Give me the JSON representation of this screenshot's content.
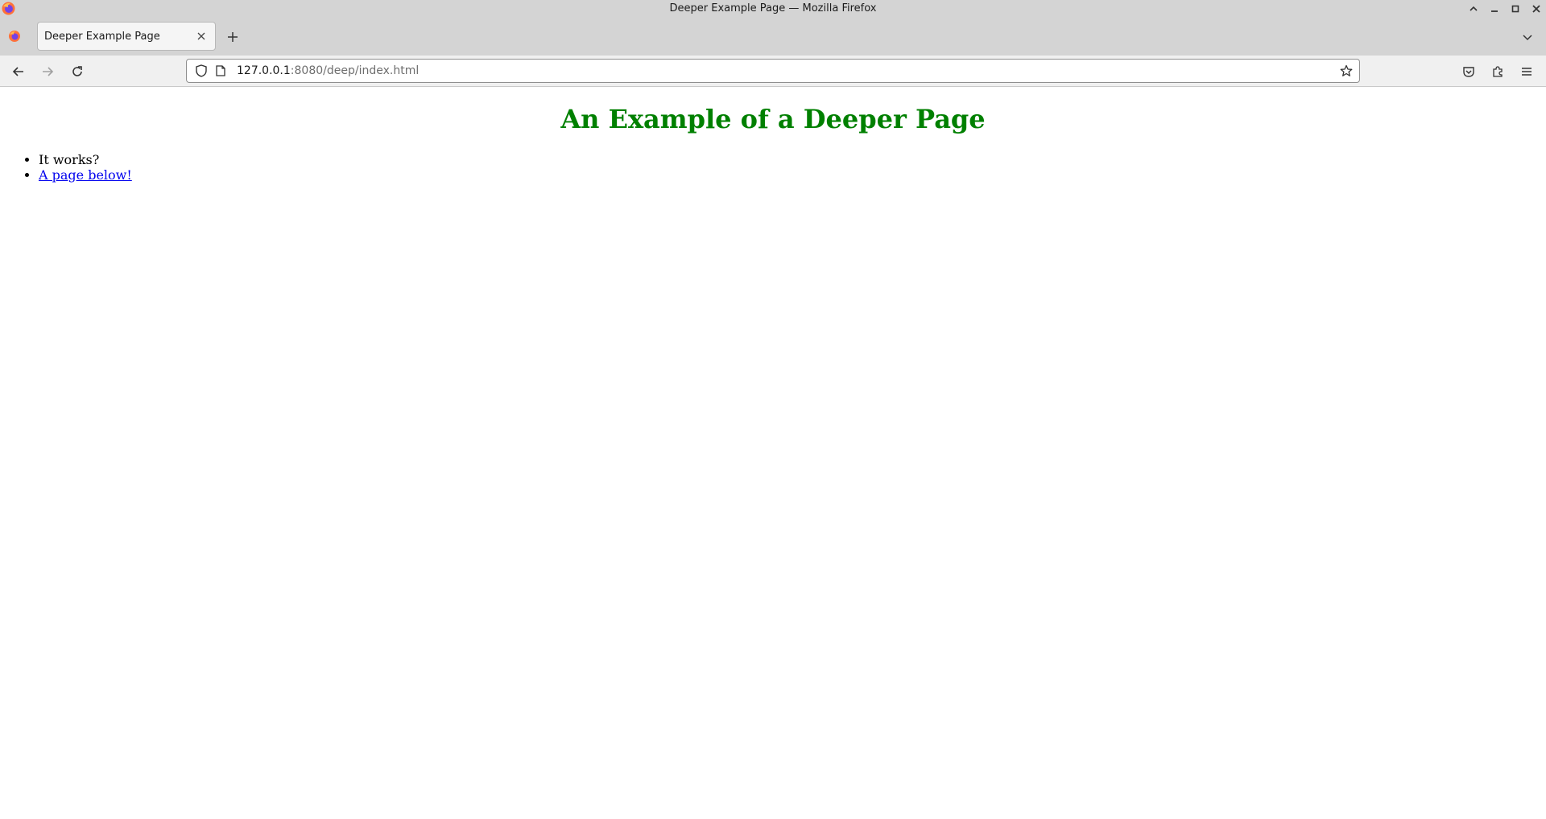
{
  "window": {
    "title": "Deeper Example Page — Mozilla Firefox"
  },
  "tabs": [
    {
      "label": "Deeper Example Page",
      "active": true
    }
  ],
  "urlbar": {
    "host": "127.0.0.1",
    "rest": ":8080/deep/index.html"
  },
  "page": {
    "heading": "An Example of a Deeper Page",
    "heading_color": "#008000",
    "items": [
      {
        "text": "It works?",
        "link": false
      },
      {
        "text": "A page below!",
        "link": true
      }
    ],
    "link_color": "#0000ee"
  }
}
